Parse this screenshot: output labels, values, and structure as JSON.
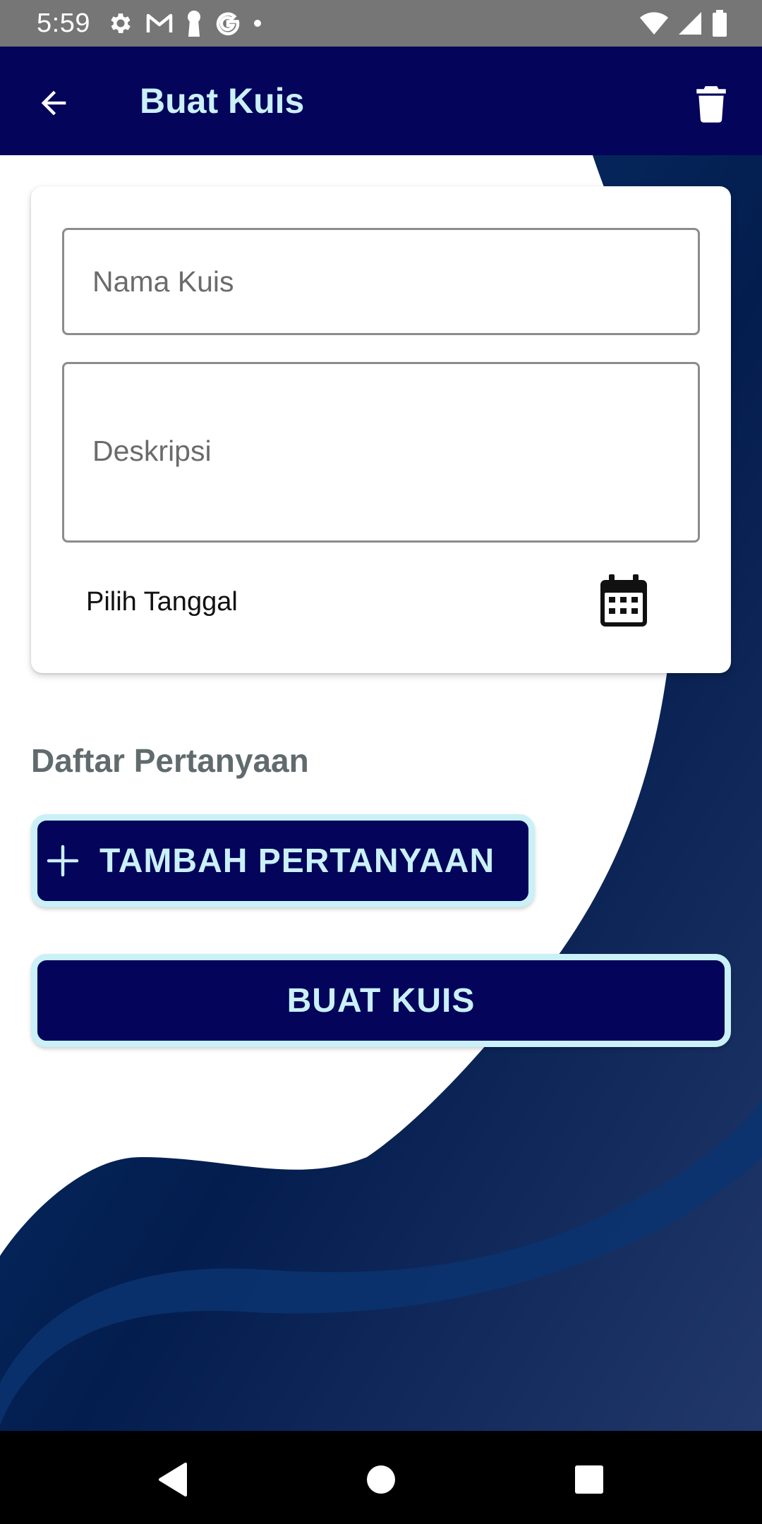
{
  "status_bar": {
    "time": "5:59",
    "left_icons": [
      "settings-icon",
      "gmail-icon",
      "keyhole-icon",
      "google-icon",
      "dot-icon"
    ],
    "right_icons": [
      "wifi-icon",
      "signal-icon",
      "battery-icon"
    ]
  },
  "app_bar": {
    "title": "Buat Kuis",
    "back_icon": "arrow-back-icon",
    "delete_icon": "trash-icon",
    "background": "#03045a",
    "title_color": "#caf0f8"
  },
  "form": {
    "name_placeholder": "Nama Kuis",
    "name_value": "",
    "description_placeholder": "Deskripsi",
    "description_value": "",
    "date_label": "Pilih Tanggal",
    "date_icon": "calendar-icon"
  },
  "questions": {
    "section_title": "Daftar Pertanyaan",
    "add_button_label": "TAMBAH PERTANYAAN",
    "add_icon": "plus-icon"
  },
  "submit": {
    "label": "BUAT KUIS"
  },
  "colors": {
    "primary": "#03045a",
    "accent": "#caf0f8",
    "wave_dark": "#031d4e",
    "wave_mid": "#0a3470",
    "wave_light": "#7ea3dd"
  },
  "nav_bar": {
    "icons": [
      "nav-back-icon",
      "nav-home-icon",
      "nav-recents-icon"
    ]
  }
}
